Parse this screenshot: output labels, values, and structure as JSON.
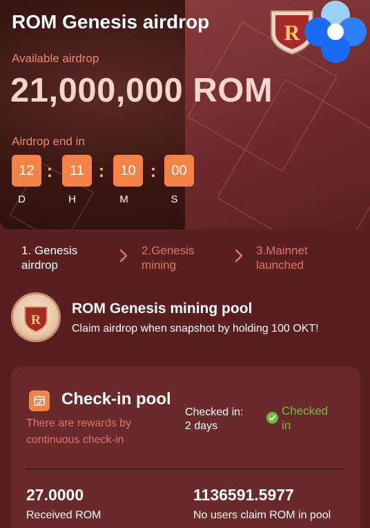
{
  "hero": {
    "title": "ROM Genesis airdrop",
    "available_label": "Available airdrop",
    "available_amount": "21,000,000 ROM",
    "end_label": "Airdrop end in",
    "countdown": [
      {
        "value": "12",
        "unit": "D"
      },
      {
        "value": "11",
        "unit": "H"
      },
      {
        "value": "10",
        "unit": "M"
      },
      {
        "value": "00",
        "unit": "S"
      }
    ],
    "separator": ":",
    "logo_letter": "R"
  },
  "steps": [
    {
      "label_line1": "1. Genesis",
      "label_line2": "airdrop",
      "active": true
    },
    {
      "label_line1": "2.Genesis",
      "label_line2": "mining",
      "active": false
    },
    {
      "label_line1": "3.Mainnet",
      "label_line2": "launched",
      "active": false
    }
  ],
  "pool": {
    "title": "ROM Genesis mining pool",
    "description": "Claim airdrop when snapshot by holding 100 OKT!",
    "badge_letter": "R"
  },
  "checkin": {
    "title": "Check-in pool",
    "subtitle_line1": "There are rewards by",
    "subtitle_line2": "continuous check-in",
    "checked_in_label": "Checked in:",
    "checked_in_days": "2 days",
    "status_line1": "Checked",
    "status_line2": "in",
    "received_value": "27.0000",
    "received_label": "Received ROM",
    "unclaimed_value": "1136591.5977",
    "unclaimed_label": "No users claim ROM in pool"
  },
  "colors": {
    "accent": "#f28246",
    "background": "#5a1f21",
    "card": "#6a2a2b",
    "muted_text": "#d8776a",
    "success": "#67c23a",
    "okx_blue": "#1a6cf5"
  },
  "icons": {
    "chevron": "chevron-right-icon",
    "calendar": "calendar-icon",
    "check": "check-circle-icon",
    "okx": "okx-logo-icon",
    "rom": "rom-shield-logo"
  }
}
